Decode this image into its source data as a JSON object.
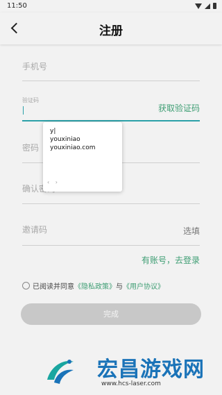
{
  "status": {
    "time": "11:50"
  },
  "header": {
    "title": "注册"
  },
  "form": {
    "phone_placeholder": "手机号",
    "code_label": "验证码",
    "get_code": "获取验证码",
    "password_placeholder": "密码",
    "confirm_placeholder": "确认密码",
    "invite_placeholder": "邀请码",
    "invite_optional": "选填",
    "has_account": "有账号，去登录"
  },
  "popup": {
    "typed": "y|",
    "suggestions": [
      "youxiniao",
      "youxiniao.com"
    ],
    "nav": "‹ ›"
  },
  "agreement": {
    "prefix": "已阅读并同意",
    "privacy": "《隐私政策》",
    "and": "与",
    "terms": "《用户协议》"
  },
  "submit_label": "完成",
  "watermark": {
    "title": "宏昌游戏网",
    "url": "www.hcs-laser.com"
  },
  "colors": {
    "accent": "#3f9e74",
    "focus": "#2aa0a8",
    "button": "#c8c8c8"
  }
}
